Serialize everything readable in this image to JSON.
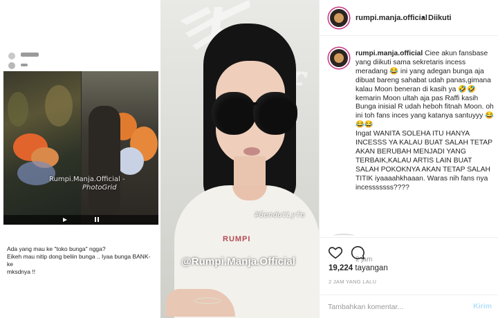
{
  "left_panel": {
    "mini_username": "",
    "mini_caption": "",
    "watermark_main": "Rumpi.Manja.Official -",
    "watermark_sub": "PhotoGrid",
    "caption_line1": "Ada yang mau ke \"toko bunga\" ngga?",
    "caption_line2": "Eikeh mau nitip dong beliin bunga .. Iyaa bunga BANK-ke",
    "caption_line3": "mksdnya !!"
  },
  "center_panel": {
    "hashtag": "#GendutLyfe",
    "handle": "@Rumpi.Manja.Official",
    "shirt_print": "RUMPI"
  },
  "header": {
    "username": "rumpi.manja.official",
    "separator": "•",
    "follow_state": "Diikuti"
  },
  "post": {
    "username": "rumpi.manja.official",
    "caption": "Ciee akun fansbase yang diikuti sama sekretaris incess meradang 😂 ini yang adegan bunga aja dibuat bareng sahabat udah panas,gimana kalau Moon beneran di kasih ya 🤣🤣 kemarin Moon ultah aja pas Raffi kasih Bunga inisial R udah heboh fitnah Moon. oh ini toh fans inces yang katanya santuyyy 😂😂😂\nIngat WANITA SOLEHA ITU HANYA INCESSS YA KALAU BUAT SALAH TETAP AKAN BERUBAH MENJADI YANG TERBAIK,KALAU ARTIS LAIN BUAT SALAH POKOKNYA AKAN TETAP SALAH TITIK iyaaaahkhaaan. Waras nih fans nya incesssssss????",
    "time": "2 jam",
    "views_count": "19,224",
    "views_label": "tayangan",
    "date": "2 JAM YANG LALU"
  },
  "comment_input": {
    "placeholder": "Tambahkan komentar...",
    "value": "",
    "send_label": "Kirim"
  },
  "colors": {
    "story_ring": "#c72e7e",
    "send_disabled": "#b2dffc",
    "muted": "#999999"
  },
  "icons": [
    "heart-icon",
    "comment-icon"
  ]
}
